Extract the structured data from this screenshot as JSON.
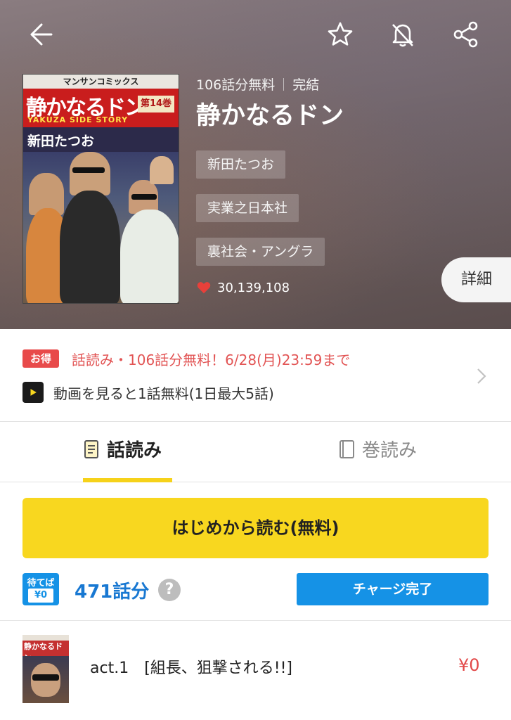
{
  "header": {
    "free_count": "106話分無料",
    "status": "完結",
    "title": "静かなるドン",
    "author": "新田たつお",
    "publisher": "実業之日本社",
    "genre": "裏社会・アングラ",
    "likes": "30,139,108",
    "detail_label": "詳細"
  },
  "cover": {
    "publisher_band": "マンサンコミックス",
    "title": "静かなるドン",
    "volume": "第14巻",
    "subtitle": "YAKUZA SIDE STORY",
    "author": "新田たつお"
  },
  "promo": {
    "badge": "お得",
    "text": "話読み・106話分無料！6/28(月)23:59まで",
    "sub": "動画を見ると1話無料(1日最大5話)"
  },
  "tabs": [
    {
      "label": "話読み",
      "active": true
    },
    {
      "label": "巻読み",
      "active": false
    }
  ],
  "read_button": "はじめから読む(無料)",
  "wait_free": {
    "line1": "待てば",
    "line2": "¥0",
    "count": "471話分",
    "charge": "チャージ完了"
  },
  "episodes": [
    {
      "title": "act.1　[組長、狙撃される!!]",
      "price": "¥0",
      "thumb_title": "静かなるドン"
    }
  ],
  "colors": {
    "accent_yellow": "#f8d71f",
    "accent_blue": "#1592e6",
    "promo_red": "#e25454",
    "heart": "#e8403a"
  },
  "icons": [
    "back-arrow-icon",
    "star-icon",
    "bell-off-icon",
    "share-icon",
    "heart-icon",
    "play-icon",
    "chevron-right-icon",
    "episode-tab-icon",
    "volume-tab-icon",
    "help-icon"
  ]
}
